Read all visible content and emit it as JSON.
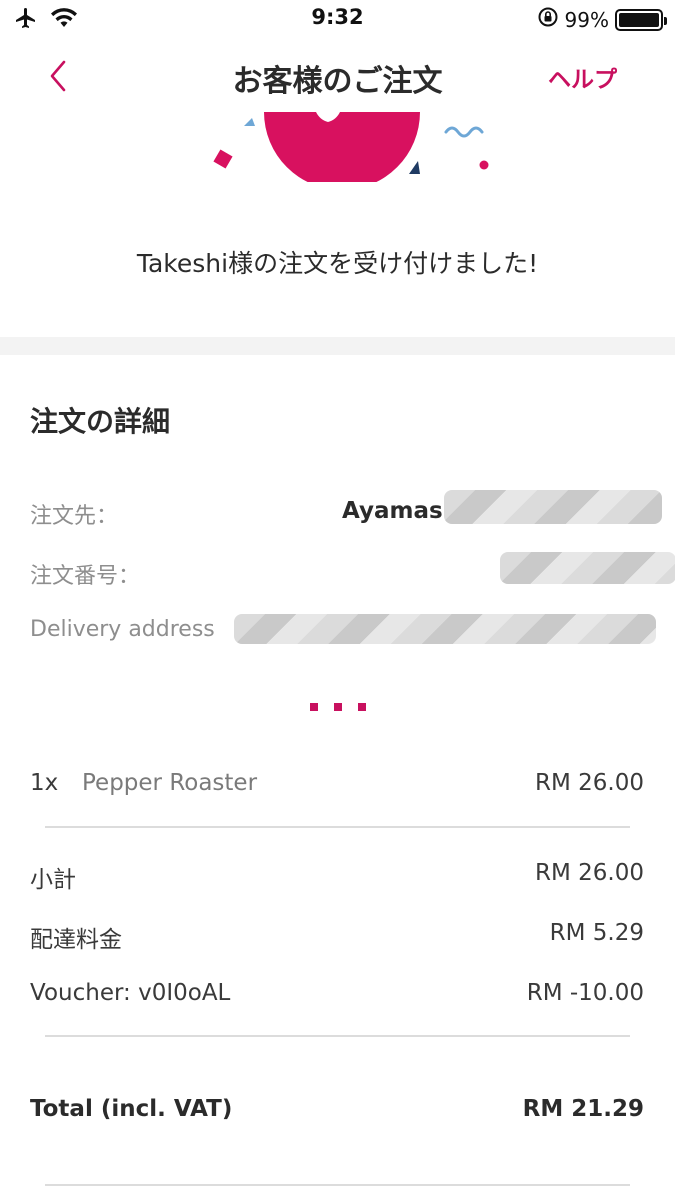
{
  "status_bar": {
    "time": "9:32",
    "battery_text": "99%",
    "battery_level": 0.99,
    "icons": [
      "airplane-icon",
      "wifi-icon",
      "orientation-lock-icon",
      "battery-icon"
    ]
  },
  "nav": {
    "back_icon": "chevron-left-icon",
    "title": "お客様のご注文",
    "help_label": "ヘルプ"
  },
  "confirmation": {
    "message": "Takeshi様の注文を受け付けました!"
  },
  "details": {
    "section_title": "注文の詳細",
    "restaurant_label": "注文先：",
    "restaurant_value": "Ayamas",
    "order_number_label": "注文番号：",
    "address_label": "Delivery address"
  },
  "items": [
    {
      "qty": "1x",
      "name": "Pepper Roaster",
      "price": "RM 26.00"
    }
  ],
  "summary": {
    "subtotal_label": "小計",
    "subtotal_value": "RM 26.00",
    "delivery_label": "配達料金",
    "delivery_value": "RM 5.29",
    "voucher_label": "Voucher: v0I0oAL",
    "voucher_value": "RM -10.00"
  },
  "total": {
    "label": "Total (incl. VAT)",
    "value": "RM 21.29"
  },
  "colors": {
    "accent": "#c8105f",
    "text": "#2b2b2b",
    "muted": "#8e8e8e",
    "divider": "#dcdcdc",
    "band": "#f3f3f3"
  }
}
